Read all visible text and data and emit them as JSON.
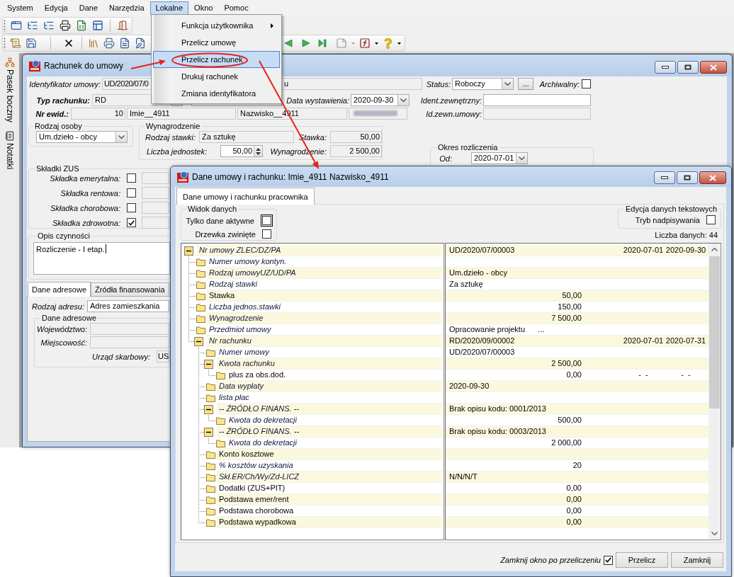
{
  "menu_bar": [
    {
      "label": "System",
      "selected": false
    },
    {
      "label": "Edycja",
      "selected": false
    },
    {
      "label": "Dane",
      "selected": false
    },
    {
      "label": "Narzędzia",
      "selected": false
    },
    {
      "label": "Lokalne",
      "selected": true
    },
    {
      "label": "Okno",
      "selected": false
    },
    {
      "label": "Pomoc",
      "selected": false
    }
  ],
  "open_menu": {
    "items": [
      {
        "label": "Funkcja użytkownika",
        "submenu": true,
        "selected": false
      },
      {
        "label": "Przelicz umowę",
        "submenu": false,
        "selected": false
      },
      {
        "label": "Przelicz rachunek",
        "submenu": false,
        "selected": true
      },
      {
        "label": "Drukuj rachunek",
        "submenu": false,
        "selected": false
      },
      {
        "label": "Zmiana identyfikatora",
        "submenu": false,
        "selected": false
      }
    ]
  },
  "sidebar": {
    "tabs": [
      {
        "label": "Pasek boczny"
      },
      {
        "label": "Notatki"
      }
    ]
  },
  "invoice_window": {
    "title": "Rachunek do umowy",
    "contract_id": {
      "label": "Identyfikator umowy:",
      "value": "UD/2020/07/0"
    },
    "field_2": {
      "value": "u"
    },
    "status": {
      "label": "Status:",
      "value": "Roboczy"
    },
    "more_button": "...",
    "archived": {
      "label": "Archiwalny:",
      "checked": false
    },
    "invoice_type": {
      "label": "Typ rachunku:",
      "value": "RD"
    },
    "issue_date": {
      "label": "Data wystawienia:",
      "value": "2020-09-30"
    },
    "external_id": {
      "label": "Ident.zewnętrzny:"
    },
    "record_no": {
      "label": "Nr ewid.:",
      "value": "10"
    },
    "first_name": {
      "value": "Imie__4911"
    },
    "last_name": {
      "value": "Nazwisko__4911"
    },
    "contract_external_id": {
      "label": "Id.zewn.umowy:"
    },
    "person_type": {
      "title": "Rodzaj osoby",
      "value": "Um.dzieło - obcy"
    },
    "remuneration": {
      "title": "Wynagrodzenie",
      "rate_type": {
        "label": "Rodzaj stawki:",
        "value": "Za sztukę"
      },
      "rate": {
        "label": "Stawka:",
        "value": "50,00"
      },
      "units": {
        "label": "Liczba jednostek:",
        "value": "50,00"
      },
      "amount": {
        "label": "Wynagrodzenie:",
        "value": "2 500,00"
      }
    },
    "settlement_period": {
      "title": "Okres rozliczenia",
      "from": {
        "label": "Od:",
        "value": "2020-07-01"
      }
    },
    "zus": {
      "title": "Składki ZUS",
      "items": [
        {
          "label": "Składka emerytalna:",
          "checked": false
        },
        {
          "label": "Składka rentowa:",
          "checked": false
        },
        {
          "label": "Składka chorobowa:",
          "checked": false
        },
        {
          "label": "Składka zdrowotna:",
          "checked": true
        }
      ]
    },
    "description": {
      "title": "Opis czynności",
      "value": "Rozliczenie - I etap."
    },
    "tabs": [
      {
        "label": "Dane adresowe",
        "selected": true
      },
      {
        "label": "Źródła finansowania",
        "selected": false
      }
    ],
    "address_type": {
      "label": "Rodzaj adresu:",
      "value": "Adres zamieszkania"
    },
    "address": {
      "title": "Dane adresowe",
      "voivodeship": {
        "label": "Województwo:"
      },
      "city": {
        "label": "Miejscowość:"
      },
      "tax_office": {
        "label": "Urząd skarbowy:",
        "value": "US"
      }
    }
  },
  "dialog": {
    "title": "Dane umowy i rachunku: Imie_4911 Nazwisko_4911",
    "tabs": [
      {
        "label": "Dane umowy i rachunku pracownika",
        "selected": true
      }
    ],
    "view": {
      "title": "Widok danych",
      "options": [
        {
          "label": "Tylko dane aktywne",
          "checked": false,
          "focused": true
        },
        {
          "label": "Drzewka zwinięte",
          "checked": false,
          "focused": false
        }
      ]
    },
    "text_editing": {
      "title": "Edycja danych tekstowych",
      "overwrite": {
        "label": "Tryb nadpisywania",
        "checked": false
      }
    },
    "data_count": "Liczba danych: 44",
    "tree": [
      {
        "label": "Nr umowy ZLEC/DZ/PA",
        "italic": true,
        "expanded": true,
        "value": {
          "kind": "text",
          "text": "UD/2020/07/00003"
        },
        "dates": [
          "2020-07-01",
          "2020-09-30"
        ],
        "children": [
          {
            "label": "Numer umowy kontyn.",
            "italic": true
          },
          {
            "label": "Rodzaj umowyUZ/UD/PA",
            "italic": true,
            "value": {
              "kind": "text",
              "text": "Um.dzieło - obcy"
            }
          },
          {
            "label": "Rodzaj stawki",
            "italic": true,
            "value": {
              "kind": "text",
              "text": "Za sztukę"
            }
          },
          {
            "label": "Stawka",
            "italic": false,
            "value": {
              "kind": "amount",
              "text": "50,00"
            }
          },
          {
            "label": "Liczba jednos.stawki",
            "italic": true,
            "value": {
              "kind": "amount",
              "text": "150,00"
            }
          },
          {
            "label": "Wynagrodzenie",
            "italic": true,
            "value": {
              "kind": "amount",
              "text": "7 500,00"
            }
          },
          {
            "label": "Przedmiot umowy",
            "italic": true,
            "value": {
              "kind": "text",
              "text": "Opracowanie projektu      ..."
            }
          },
          {
            "label": "Nr rachunku",
            "italic": true,
            "expanded": true,
            "value": {
              "kind": "text",
              "text": "RD/2020/09/00002"
            },
            "dates": [
              "2020-07-01",
              "2020-07-31"
            ],
            "children": [
              {
                "label": "Numer umowy",
                "italic": true,
                "value": {
                  "kind": "text",
                  "text": "UD/2020/07/00003"
                }
              },
              {
                "label": "Kwota rachunku",
                "italic": true,
                "expanded": true,
                "value": {
                  "kind": "amount",
                  "text": "2 500,00"
                },
                "children": [
                  {
                    "label": "plus za obs.dod.",
                    "italic": false,
                    "value": {
                      "kind": "amount",
                      "text": "0,00"
                    },
                    "dates": [
                      "-  -",
                      "-  -"
                    ]
                  }
                ]
              },
              {
                "label": "Data wypłaty",
                "italic": true,
                "value": {
                  "kind": "text",
                  "text": "2020-09-30"
                }
              },
              {
                "label": "lista płac",
                "italic": true
              },
              {
                "label": "-- ŹRÓDŁO FINANS. --",
                "italic": true,
                "expanded": true,
                "value": {
                  "kind": "text",
                  "text": "Brak opisu kodu: 0001/2013"
                },
                "children": [
                  {
                    "label": "Kwota do dekretacji",
                    "italic": true,
                    "value": {
                      "kind": "amount",
                      "text": "500,00"
                    }
                  }
                ]
              },
              {
                "label": "-- ŹRÓDŁO FINANS. --",
                "italic": true,
                "expanded": true,
                "value": {
                  "kind": "text",
                  "text": "Brak opisu kodu: 0003/2013"
                },
                "children": [
                  {
                    "label": "Kwota do dekretacji",
                    "italic": true,
                    "value": {
                      "kind": "amount",
                      "text": "2 000,00"
                    }
                  }
                ]
              },
              {
                "label": "Konto kosztowe",
                "italic": false
              },
              {
                "label": "% kosztów uzyskania",
                "italic": true,
                "value": {
                  "kind": "amount",
                  "text": "20"
                }
              },
              {
                "label": "Skł.ER/Ch/Wy/Zd-LICZ",
                "italic": true,
                "value": {
                  "kind": "text",
                  "text": "N/N/N/T"
                }
              },
              {
                "label": "Dodatki (ZUS+PIT)",
                "italic": false,
                "value": {
                  "kind": "amount",
                  "text": "0,00"
                }
              },
              {
                "label": "Podstawa emer/rent",
                "italic": false,
                "value": {
                  "kind": "amount",
                  "text": "0,00"
                }
              },
              {
                "label": "Podstawa chorobowa",
                "italic": false,
                "value": {
                  "kind": "amount",
                  "text": "0,00"
                }
              },
              {
                "label": "Podstawa wypadkowa",
                "italic": false,
                "value": {
                  "kind": "amount",
                  "text": "0,00"
                }
              }
            ]
          }
        ]
      }
    ],
    "close_after": {
      "label": "Zamknij okno po przeliczeniu",
      "checked": true
    },
    "buttons": [
      "Przelicz",
      "Zamknij"
    ]
  }
}
